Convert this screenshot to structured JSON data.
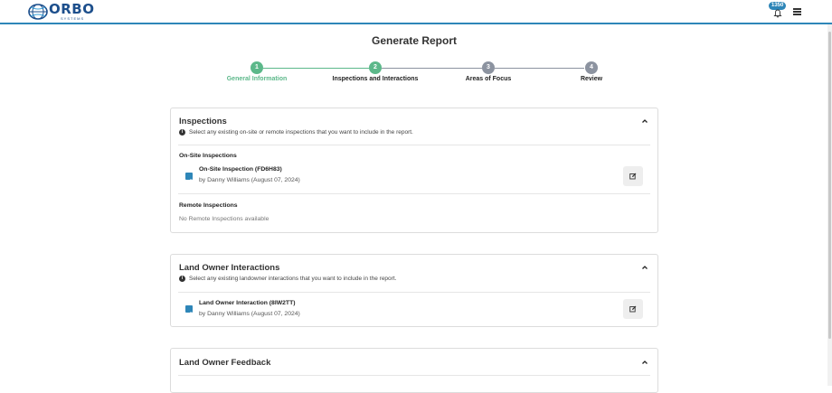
{
  "header": {
    "logo_text": "ORBO",
    "logo_sub": "SYSTEMS",
    "notification_count": "1350",
    "accent": "#2e86b8"
  },
  "page": {
    "title": "Generate Report"
  },
  "stepper": {
    "steps": [
      {
        "number": "1",
        "label": "General Information",
        "state": "done"
      },
      {
        "number": "2",
        "label": "Inspections and Interactions",
        "state": "active"
      },
      {
        "number": "3",
        "label": "Areas of Focus",
        "state": "pending"
      },
      {
        "number": "4",
        "label": "Review",
        "state": "pending"
      }
    ],
    "colors": {
      "done": "#5cb88a",
      "active": "#5cb88a",
      "pending": "#8c93a0"
    }
  },
  "inspections": {
    "title": "Inspections",
    "info": "Select any existing on-site or remote inspections that you want to include in the report.",
    "onsite_title": "On-Site Inspections",
    "onsite_items": [
      {
        "title": "On-Site Inspection (FD6H83)",
        "subtitle": "by Danny Williams (August 07, 2024)",
        "checked": true
      }
    ],
    "remote_title": "Remote Inspections",
    "remote_empty": "No Remote Inspections available"
  },
  "interactions": {
    "title": "Land Owner Interactions",
    "info": "Select any existing landowner interactions that you want to include in the report.",
    "items": [
      {
        "title": "Land Owner Interaction (8IW2TT)",
        "subtitle": "by Danny Williams (August 07, 2024)",
        "checked": true
      }
    ]
  },
  "feedback": {
    "title": "Land Owner Feedback"
  }
}
